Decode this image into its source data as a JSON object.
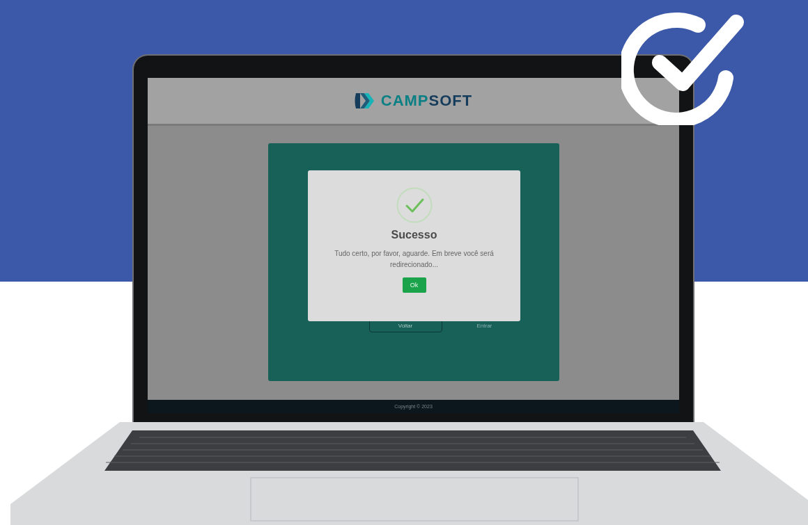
{
  "page": {
    "logo": {
      "part_1": "CAMP",
      "part_2": "SOFT"
    },
    "card": {
      "buttons": [
        {
          "label": "Voltar",
          "kind": "outline"
        },
        {
          "label": "Entrar",
          "kind": "text"
        }
      ]
    },
    "footer": {
      "text": "Copyright © 2023"
    }
  },
  "dialog": {
    "title": "Sucesso",
    "message": "Tudo certo, por favor, aguarde. Em breve você será redirecionado...",
    "button": "Ok"
  }
}
